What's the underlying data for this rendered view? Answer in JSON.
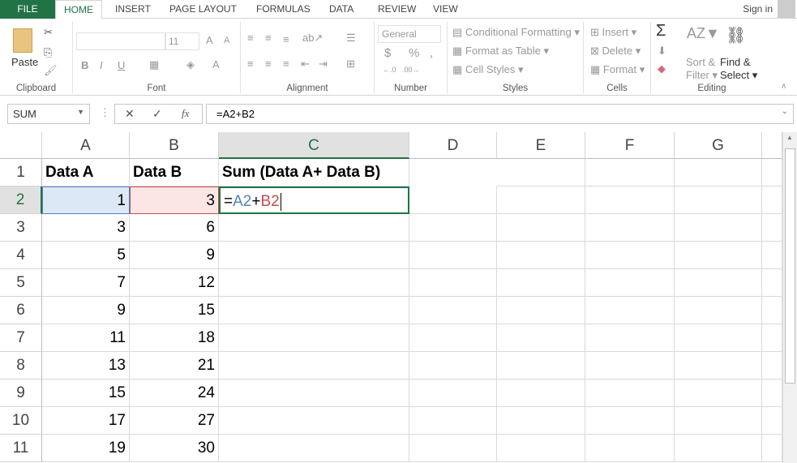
{
  "tabs": [
    "FILE",
    "HOME",
    "INSERT",
    "PAGE LAYOUT",
    "FORMULAS",
    "DATA",
    "REVIEW",
    "VIEW"
  ],
  "sign_in": "Sign in",
  "ribbon": {
    "clipboard": {
      "label": "Clipboard",
      "paste": "Paste"
    },
    "font": {
      "label": "Font",
      "size": "11",
      "bold": "B",
      "italic": "I",
      "underline": "U"
    },
    "alignment": {
      "label": "Alignment"
    },
    "number": {
      "label": "Number",
      "format": "General",
      "currency": "$",
      "percent": "%",
      "comma": ","
    },
    "styles": {
      "label": "Styles",
      "conditional": "Conditional Formatting",
      "format_table": "Format as Table",
      "cell_styles": "Cell Styles"
    },
    "cells": {
      "label": "Cells",
      "insert": "Insert",
      "delete": "Delete",
      "format": "Format"
    },
    "editing": {
      "label": "Editing",
      "sort1": "Sort &",
      "sort2": "Filter",
      "find1": "Find &",
      "find2": "Select"
    }
  },
  "formula_bar": {
    "name_box": "SUM",
    "fx": "fx",
    "cancel": "✕",
    "enter": "✓",
    "formula": "=A2+B2"
  },
  "columns": [
    "A",
    "B",
    "C",
    "D",
    "E",
    "F",
    "G"
  ],
  "rows": [
    "1",
    "2",
    "3",
    "4",
    "5",
    "6",
    "7",
    "8",
    "9",
    "10",
    "11"
  ],
  "headers": [
    "Data A",
    "Data B",
    "Sum (Data A+ Data B)"
  ],
  "data_a": [
    "1",
    "3",
    "5",
    "7",
    "9",
    "11",
    "13",
    "15",
    "17",
    "19"
  ],
  "data_b": [
    "3",
    "6",
    "9",
    "12",
    "15",
    "18",
    "21",
    "24",
    "27",
    "30"
  ],
  "edit": {
    "eq": "=",
    "ref_a": "A2",
    "plus": "+",
    "ref_b": "B2"
  },
  "colors": {
    "accent": "#217346",
    "ref_a": "#4f81bd",
    "ref_b": "#c0504d"
  }
}
